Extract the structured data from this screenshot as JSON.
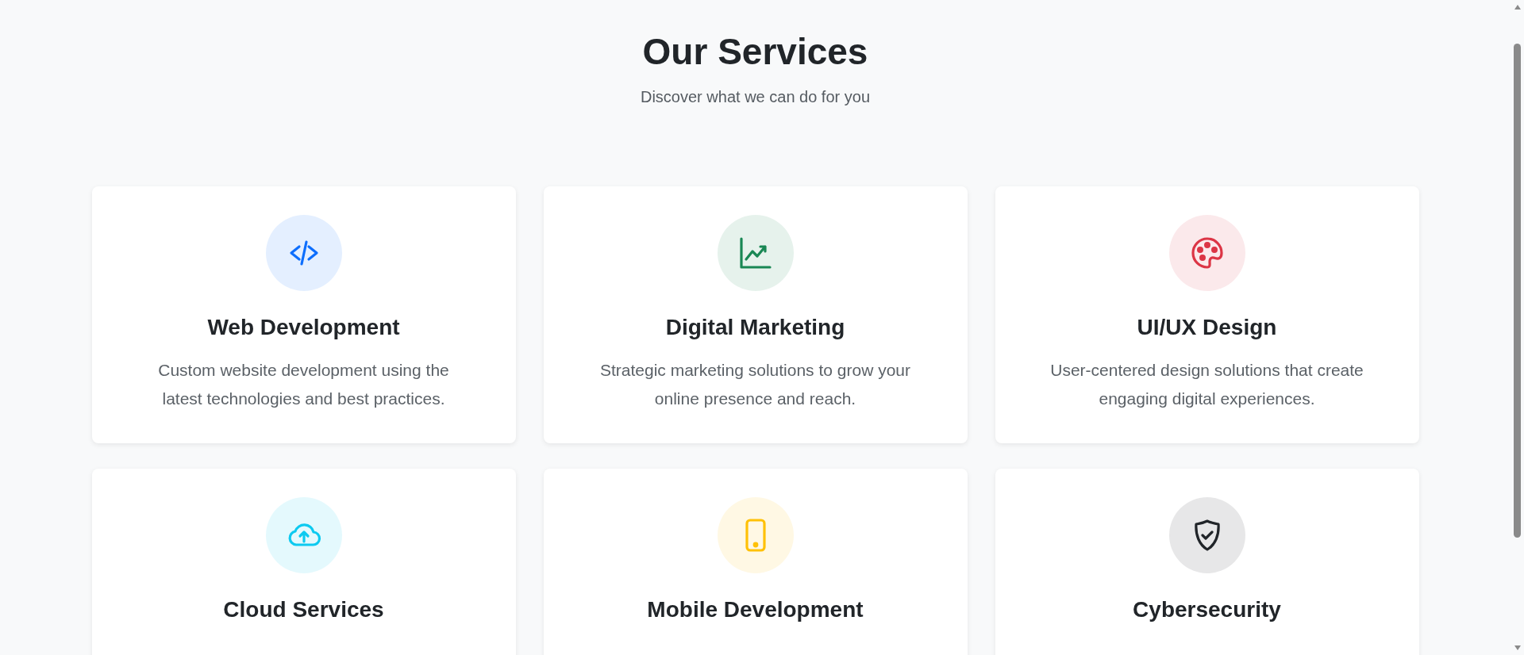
{
  "header": {
    "title": "Our Services",
    "subtitle": "Discover what we can do for you"
  },
  "services": [
    {
      "color": "#0d6efd",
      "title": "Web Development",
      "description": "Custom website development using the latest technologies and best practices."
    },
    {
      "color": "#198754",
      "title": "Digital Marketing",
      "description": "Strategic marketing solutions to grow your online presence and reach."
    },
    {
      "color": "#dc3545",
      "title": "UI/UX Design",
      "description": "User-centered design solutions that create engaging digital experiences."
    },
    {
      "color": "#0dcaf0",
      "title": "Cloud Services"
    },
    {
      "color": "#ffc107",
      "title": "Mobile Development"
    },
    {
      "color": "#212529",
      "title": "Cybersecurity"
    }
  ]
}
